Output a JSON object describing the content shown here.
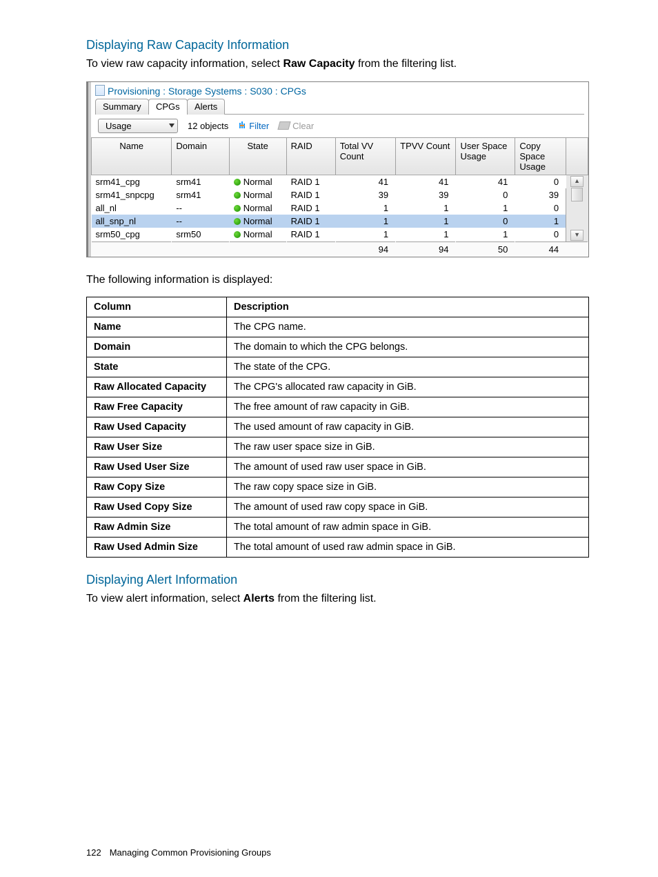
{
  "headings": {
    "rawCapacity": "Displaying Raw Capacity Information",
    "alerts": "Displaying Alert Information"
  },
  "paragraphs": {
    "rawCapacity_pre": "To view raw capacity information, select ",
    "rawCapacity_bold": "Raw Capacity",
    "rawCapacity_post": " from the filtering list.",
    "followingInfo": "The following information is displayed:",
    "alerts_pre": "To view alert information, select ",
    "alerts_bold": "Alerts",
    "alerts_post": " from the filtering list."
  },
  "panel": {
    "breadcrumb": "Provisioning : Storage Systems : S030 : CPGs",
    "tabs": {
      "summary": "Summary",
      "cpgs": "CPGs",
      "alerts": "Alerts"
    },
    "toolbar": {
      "dropdownValue": "Usage",
      "objects": "12 objects",
      "filter": "Filter",
      "clear": "Clear"
    },
    "grid": {
      "columns": {
        "name": "Name",
        "domain": "Domain",
        "state": "State",
        "raid": "RAID",
        "totalVV": "Total VV Count",
        "tpvv": "TPVV Count",
        "userSpace": "User Space Usage",
        "copySpace": "Copy Space Usage"
      },
      "stateLabel": "Normal",
      "rows": [
        {
          "name": "srm41_cpg",
          "domain": "srm41",
          "raid": "RAID 1",
          "tv": "41",
          "tp": "41",
          "us": "41",
          "cs": "0"
        },
        {
          "name": "srm41_snpcpg",
          "domain": "srm41",
          "raid": "RAID 1",
          "tv": "39",
          "tp": "39",
          "us": "0",
          "cs": "39"
        },
        {
          "name": "all_nl",
          "domain": "--",
          "raid": "RAID 1",
          "tv": "1",
          "tp": "1",
          "us": "1",
          "cs": "0"
        },
        {
          "name": "all_snp_nl",
          "domain": "--",
          "raid": "RAID 1",
          "tv": "1",
          "tp": "1",
          "us": "0",
          "cs": "1"
        },
        {
          "name": "srm50_cpg",
          "domain": "srm50",
          "raid": "RAID 1",
          "tv": "1",
          "tp": "1",
          "us": "1",
          "cs": "0"
        }
      ],
      "totals": {
        "tv": "94",
        "tp": "94",
        "us": "50",
        "cs": "44"
      }
    }
  },
  "descTable": {
    "headers": {
      "column": "Column",
      "description": "Description"
    },
    "rows": [
      {
        "c": "Name",
        "d": "The CPG name."
      },
      {
        "c": "Domain",
        "d": "The domain to which the CPG belongs."
      },
      {
        "c": "State",
        "d": "The state of the CPG."
      },
      {
        "c": "Raw Allocated Capacity",
        "d": "The CPG's allocated raw capacity in GiB."
      },
      {
        "c": "Raw Free Capacity",
        "d": "The free amount of raw capacity in GiB."
      },
      {
        "c": "Raw Used Capacity",
        "d": "The used amount of raw capacity in GiB."
      },
      {
        "c": "Raw User Size",
        "d": "The raw user space size in GiB."
      },
      {
        "c": "Raw Used User Size",
        "d": "The amount of used raw user space in GiB."
      },
      {
        "c": "Raw Copy Size",
        "d": "The raw copy space size in GiB."
      },
      {
        "c": "Raw Used Copy Size",
        "d": "The amount of used raw copy space in GiB."
      },
      {
        "c": "Raw Admin Size",
        "d": "The total amount of raw admin space in GiB."
      },
      {
        "c": "Raw Used Admin Size",
        "d": "The total amount of used raw admin space in GiB."
      }
    ]
  },
  "footer": {
    "page": "122",
    "title": "Managing Common Provisioning Groups"
  }
}
